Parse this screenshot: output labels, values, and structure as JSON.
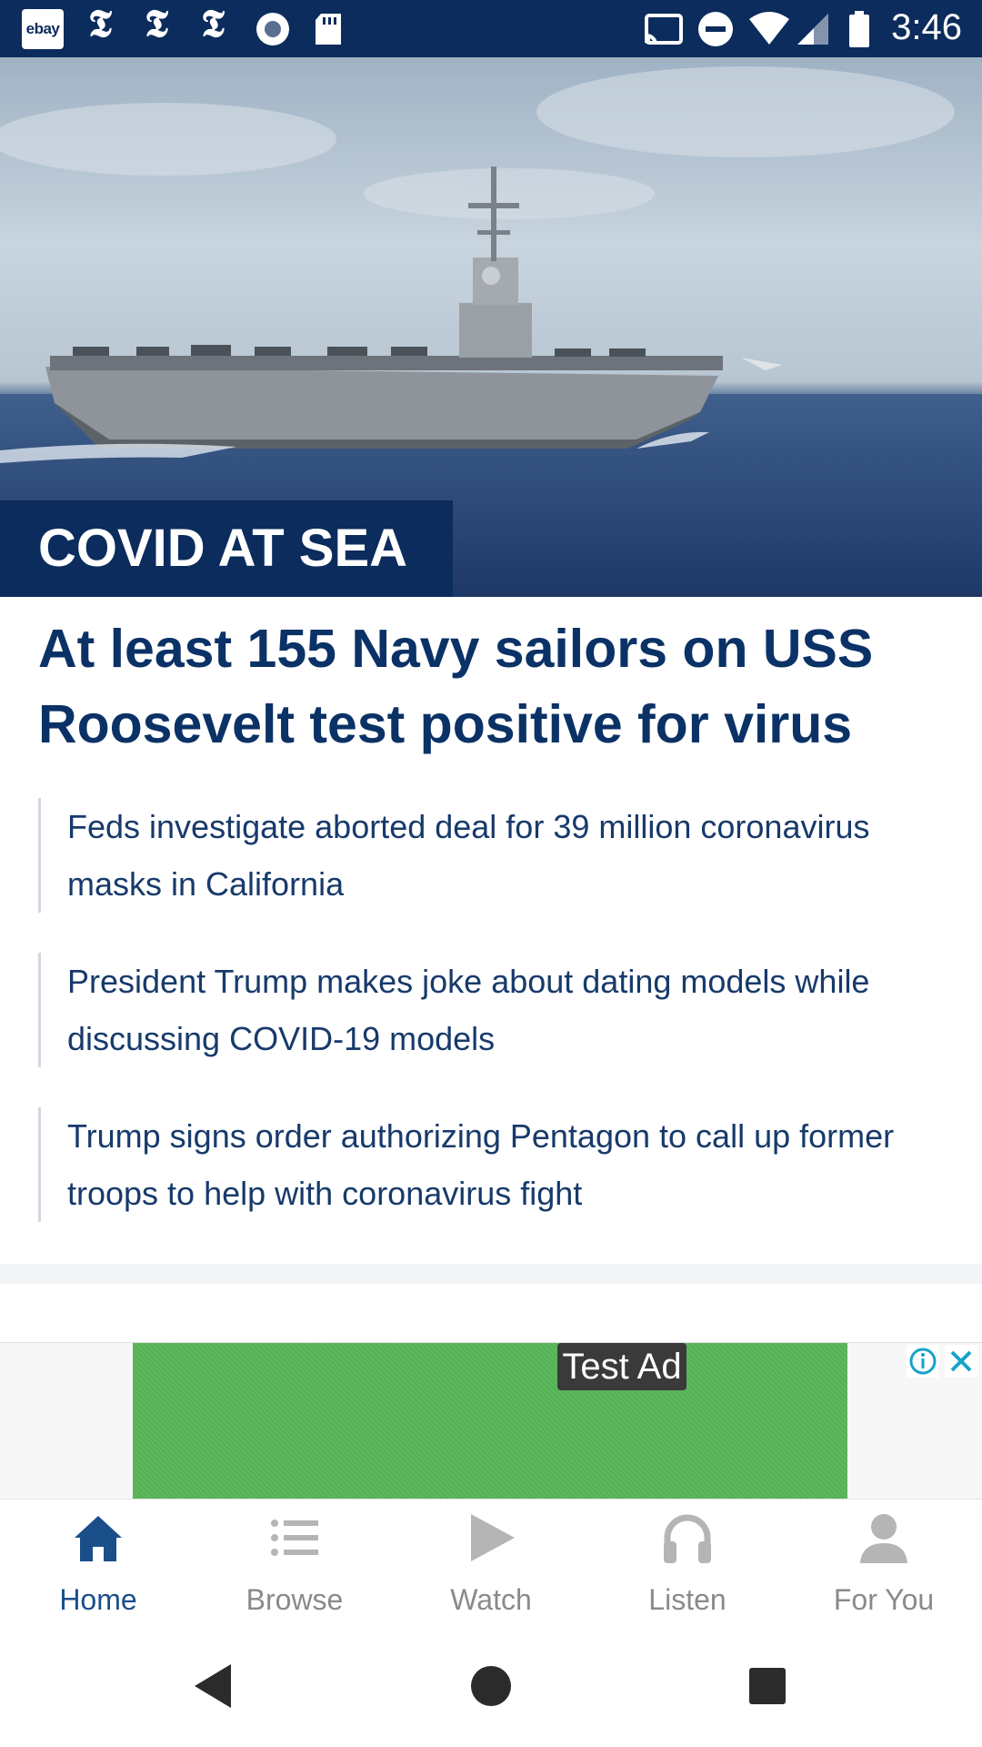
{
  "status_bar": {
    "ebay_label": "ebay",
    "nyt_glyph": "𝕿",
    "time": "3:46",
    "icons": [
      "ebay-icon",
      "nyt-icon",
      "nyt-icon",
      "nyt-icon",
      "record-icon",
      "sd-card-icon",
      "cast-icon",
      "do-not-disturb-icon",
      "wifi-icon",
      "signal-icon",
      "battery-icon"
    ]
  },
  "hero": {
    "kicker": "COVID AT SEA",
    "image_desc": "aircraft-carrier-photo"
  },
  "headline": "At least 155 Navy sailors on USS Roosevelt test positive for virus",
  "related": [
    "Feds investigate aborted deal for 39 million coronavirus masks in California",
    "President Trump makes joke about dating models while discussing COVID-19 models",
    "Trump signs order authorizing Pentagon to call up former troops to help with coronavirus fight"
  ],
  "ad": {
    "label": "Test Ad"
  },
  "bottom_nav": {
    "items": [
      {
        "label": "Home",
        "icon": "home-icon",
        "active": true
      },
      {
        "label": "Browse",
        "icon": "list-icon",
        "active": false
      },
      {
        "label": "Watch",
        "icon": "play-icon",
        "active": false
      },
      {
        "label": "Listen",
        "icon": "headphones-icon",
        "active": false
      },
      {
        "label": "For You",
        "icon": "person-icon",
        "active": false
      }
    ]
  },
  "colors": {
    "brand_navy": "#0b2c5c",
    "headline": "#0b3266",
    "nav_active": "#1b4f8a",
    "nav_inactive": "#8a8a8a",
    "ad_green": "#5cb85c"
  }
}
